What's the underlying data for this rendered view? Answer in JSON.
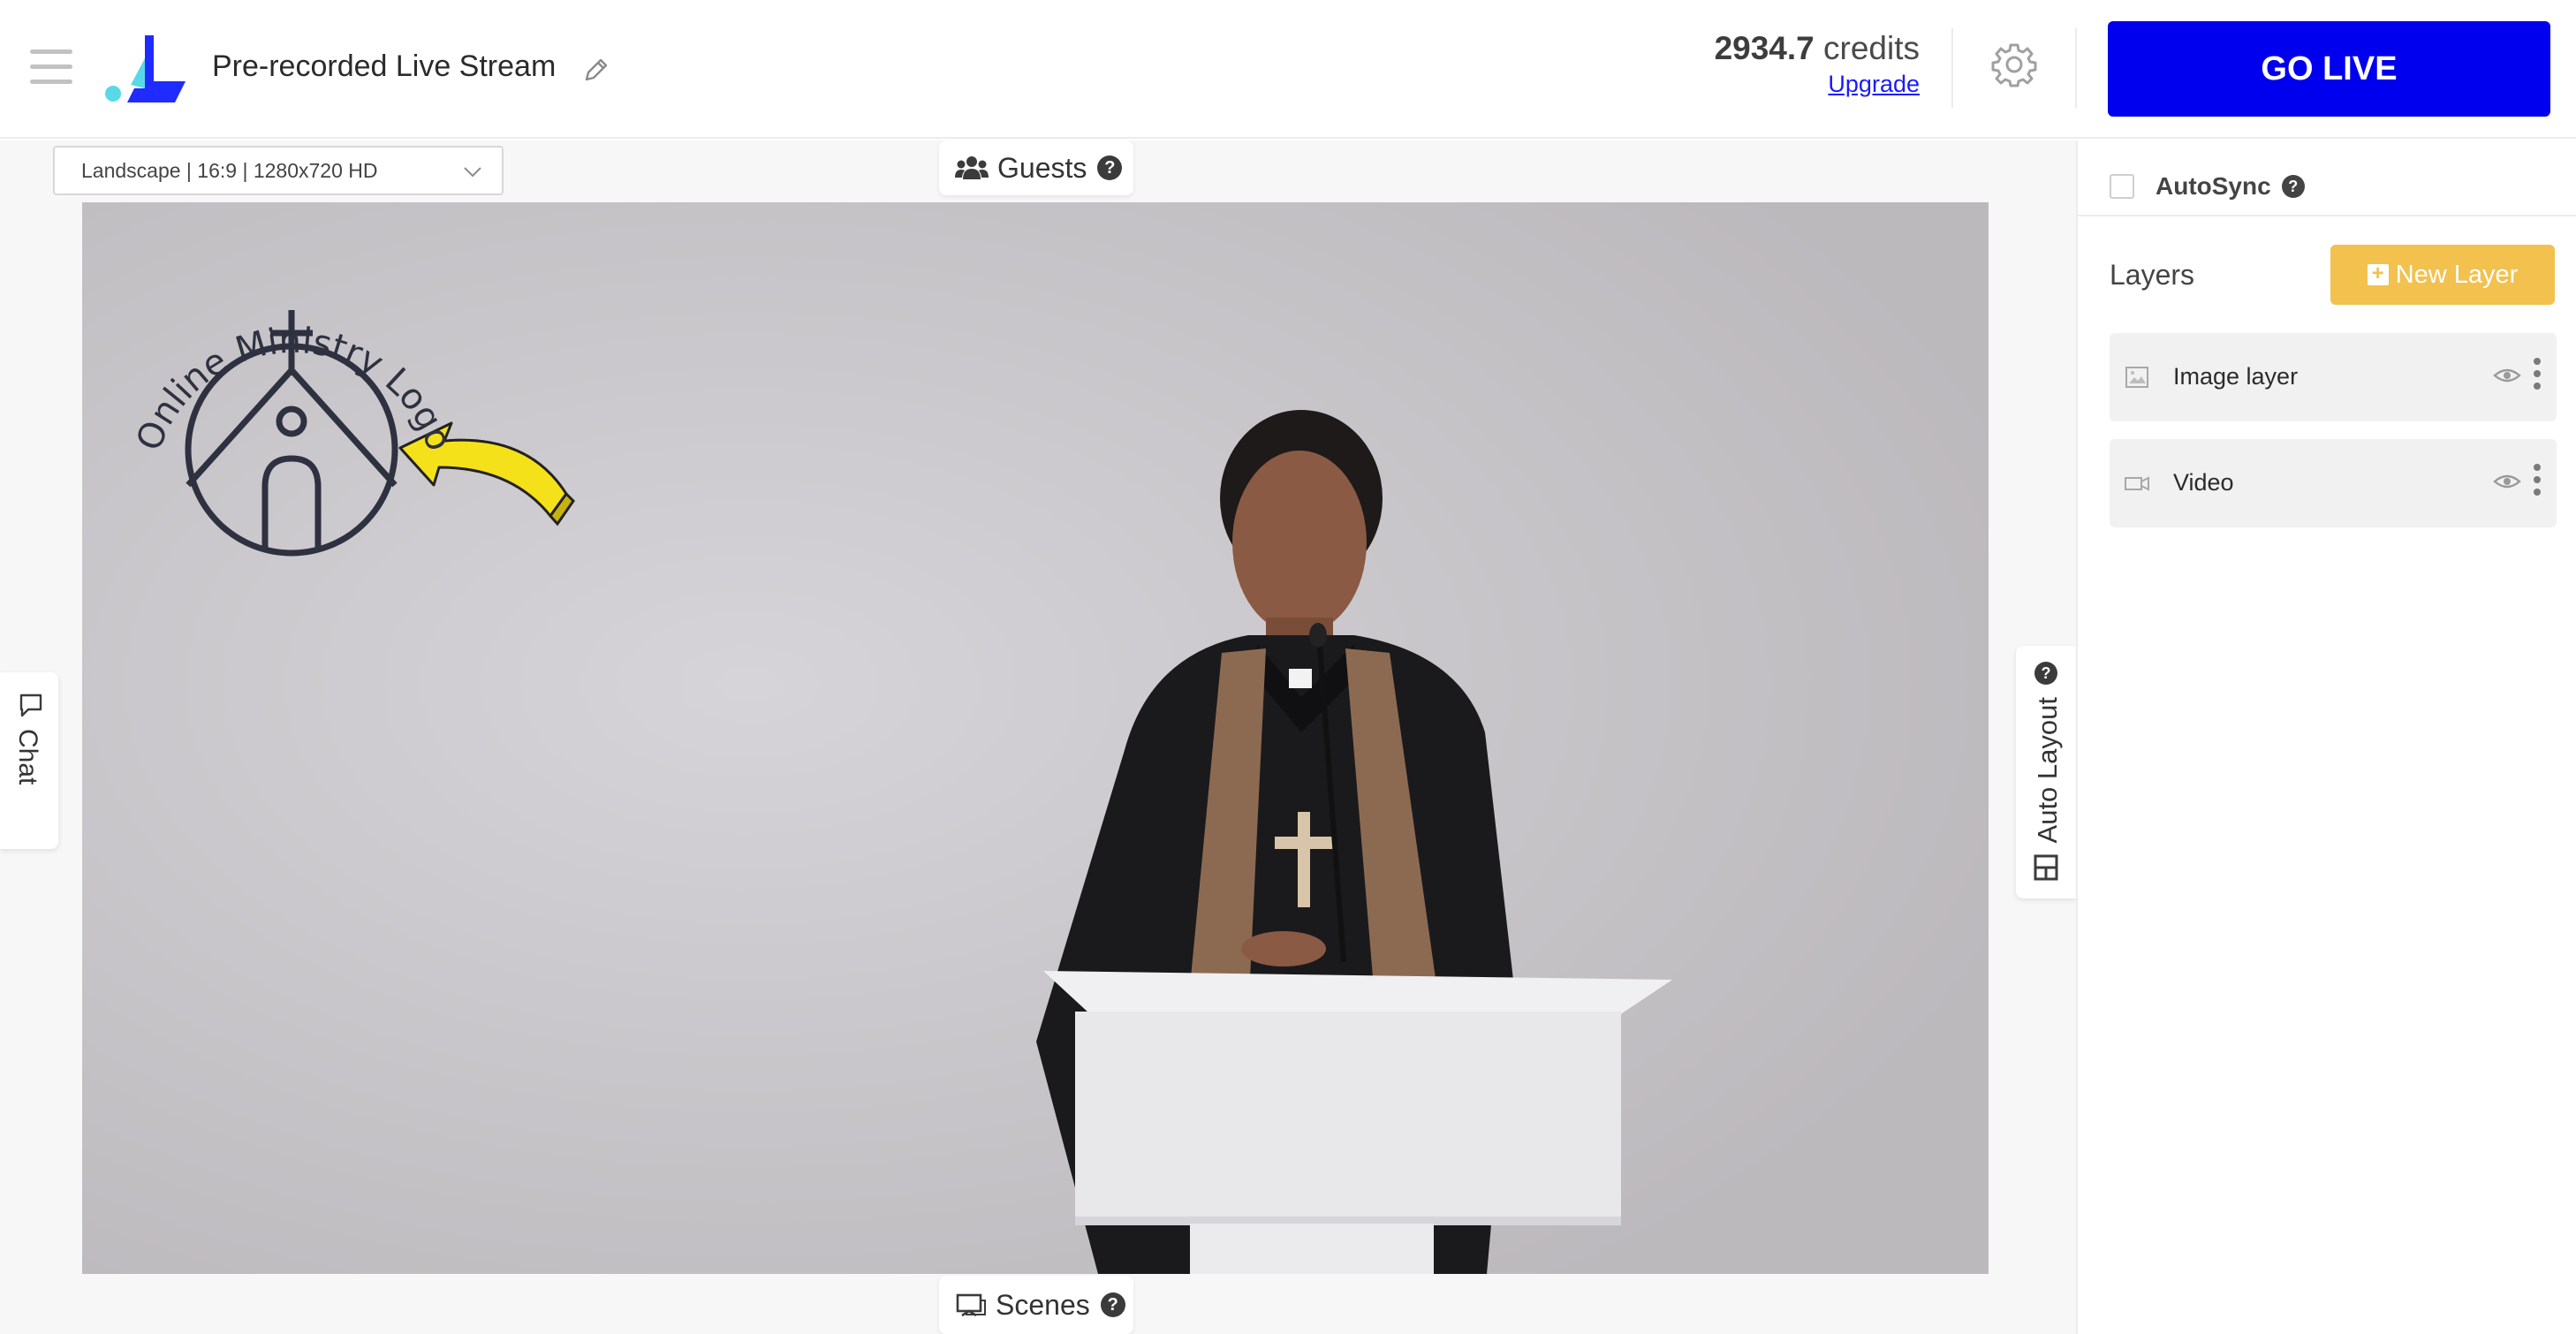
{
  "header": {
    "title": "Pre-recorded Live Stream",
    "credits_value": "2934.7",
    "credits_unit": "credits",
    "upgrade_label": "Upgrade",
    "go_live_label": "GO LIVE",
    "brand_color": "#0000ee",
    "logo_accent": "#59d9e8"
  },
  "toolbar": {
    "layout_select_value": "Landscape | 16:9 | 1280x720 HD",
    "guests_label": "Guests",
    "scenes_label": "Scenes",
    "help_glyph": "?"
  },
  "side_tabs": {
    "chat_label": "Chat",
    "auto_layout_label": "Auto Layout"
  },
  "stage": {
    "logo_text": "Online Ministry Logo",
    "arrow_color": "#f5e11a"
  },
  "panel": {
    "autosync_label": "AutoSync",
    "autosync_checked": false,
    "layers_title": "Layers",
    "new_layer_label": "New Layer",
    "new_layer_color": "#f2c14e",
    "layers": [
      {
        "name": "Image layer",
        "icon": "image-icon",
        "visible": true
      },
      {
        "name": "Video",
        "icon": "video-camera-icon",
        "visible": true
      }
    ]
  }
}
